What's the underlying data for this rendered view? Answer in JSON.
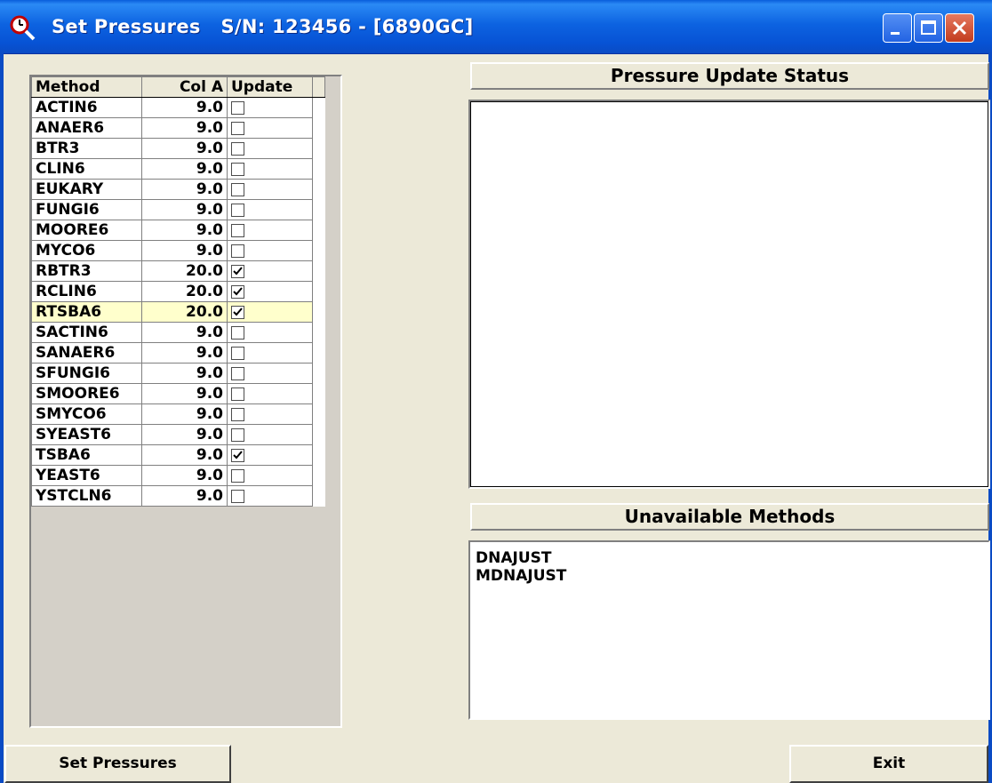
{
  "window": {
    "title": "Set Pressures   S/N: 123456 - [6890GC]",
    "icon": "clock-magnifier-icon",
    "controls": [
      "minimize-icon",
      "maximize-icon",
      "close-icon"
    ]
  },
  "grid": {
    "headers": {
      "method": "Method",
      "cola": "Col A",
      "update": "Update"
    },
    "selected_index": 11,
    "rows": [
      {
        "method": "ACTIN6",
        "cola": "9.0",
        "update": false
      },
      {
        "method": "ANAER6",
        "cola": "9.0",
        "update": false
      },
      {
        "method": "BTR3",
        "cola": "9.0",
        "update": false
      },
      {
        "method": "CLIN6",
        "cola": "9.0",
        "update": false
      },
      {
        "method": "EUKARY",
        "cola": "9.0",
        "update": false
      },
      {
        "method": "FUNGI6",
        "cola": "9.0",
        "update": false
      },
      {
        "method": "MOORE6",
        "cola": "9.0",
        "update": false
      },
      {
        "method": "MYCO6",
        "cola": "9.0",
        "update": false
      },
      {
        "method": "RBTR3",
        "cola": "20.0",
        "update": true
      },
      {
        "method": "RCLIN6",
        "cola": "20.0",
        "update": true
      },
      {
        "method": "RTSBA6",
        "cola": "20.0",
        "update": true
      },
      {
        "method": "SACTIN6",
        "cola": "9.0",
        "update": false
      },
      {
        "method": "SANAER6",
        "cola": "9.0",
        "update": false
      },
      {
        "method": "SFUNGI6",
        "cola": "9.0",
        "update": false
      },
      {
        "method": "SMOORE6",
        "cola": "9.0",
        "update": false
      },
      {
        "method": "SMYCO6",
        "cola": "9.0",
        "update": false
      },
      {
        "method": "SYEAST6",
        "cola": "9.0",
        "update": false
      },
      {
        "method": "TSBA6",
        "cola": "9.0",
        "update": true
      },
      {
        "method": "YEAST6",
        "cola": "9.0",
        "update": false
      },
      {
        "method": "YSTCLN6",
        "cola": "9.0",
        "update": false
      }
    ]
  },
  "status": {
    "label": "Pressure Update Status",
    "text": ""
  },
  "unavailable": {
    "label": "Unavailable Methods",
    "items": [
      "DNAJUST",
      "MDNAJUST"
    ]
  },
  "buttons": {
    "set_pressures": "Set Pressures",
    "exit": "Exit"
  },
  "colors": {
    "selected_row": "#FFFFCC",
    "titlebar": "#0D63E1",
    "face": "#ECE9D8"
  }
}
